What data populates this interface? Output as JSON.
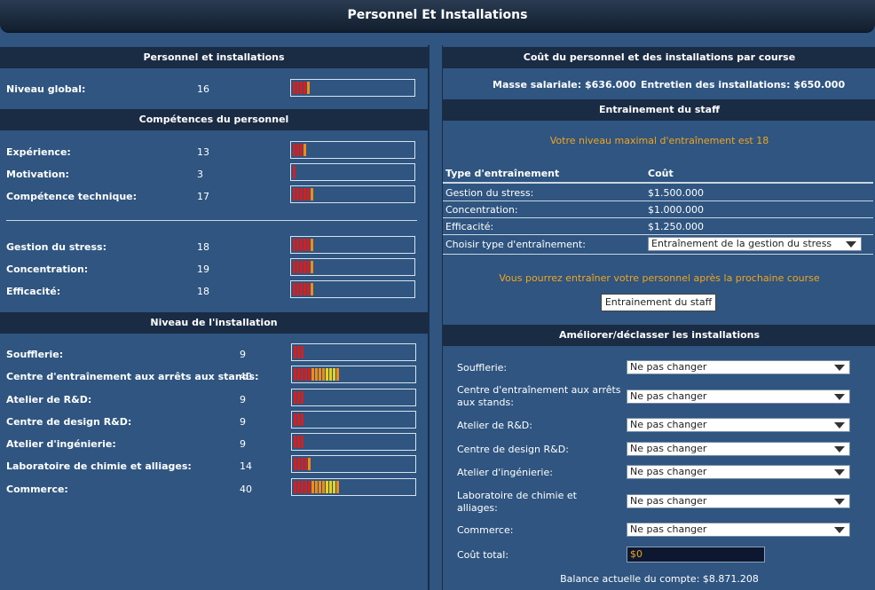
{
  "page_title": "Personnel Et Installations",
  "left": {
    "personnel_header": "Personnel et installations",
    "global": {
      "label": "Niveau global:",
      "value": "16",
      "level": 16
    },
    "skills_header": "Compétences du personnel",
    "skills": [
      {
        "label": "Expérience:",
        "value": "13",
        "level": 13
      },
      {
        "label": "Motivation:",
        "value": "3",
        "level": 3
      },
      {
        "label": "Compétence technique:",
        "value": "17",
        "level": 17
      }
    ],
    "training_skills": [
      {
        "label": "Gestion du stress:",
        "value": "18",
        "level": 18
      },
      {
        "label": "Concentration:",
        "value": "19",
        "level": 19
      },
      {
        "label": "Efficacité:",
        "value": "18",
        "level": 18
      }
    ],
    "facility_header": "Niveau de l'installation",
    "facilities": [
      {
        "label": "Soufflerie:",
        "value": "9",
        "level": 9
      },
      {
        "label": "Centre d'entraînement aux arrêts aux stands:",
        "value": "40",
        "level": 40
      },
      {
        "label": "Atelier de R&D:",
        "value": "9",
        "level": 9
      },
      {
        "label": "Centre de design R&D:",
        "value": "9",
        "level": 9
      },
      {
        "label": "Atelier d'ingénierie:",
        "value": "9",
        "level": 9
      },
      {
        "label": "Laboratoire de chimie et alliages:",
        "value": "14",
        "level": 14
      },
      {
        "label": "Commerce:",
        "value": "40",
        "level": 40
      }
    ]
  },
  "right": {
    "cost_header": "Coût du personnel et des installations par course",
    "salary": "Masse salariale: $636.000",
    "maintenance": "Entretien des installations: $650.000",
    "staff_training_header": "Entrainement du staff",
    "max_training_msg": "Votre niveau maximal d'entraînement est 18",
    "table_headers": {
      "type": "Type d'entraînement",
      "cost": "Coût"
    },
    "training_rows": [
      {
        "type": "Gestion du stress:",
        "cost": "$1.500.000"
      },
      {
        "type": "Concentration:",
        "cost": "$1.000.000"
      },
      {
        "type": "Efficacité:",
        "cost": "$1.250.000"
      }
    ],
    "choose_label": "Choisir type d'entraînement:",
    "choose_value": "Entraînement de la gestion du stress",
    "next_race_msg": "Vous pourrez entraîner votre personnel après la prochaine course",
    "train_button": "Entrainement du staff",
    "upgrade_header": "Améliorer/déclasser les installations",
    "upgrade_rows": [
      {
        "label": "Soufflerie:",
        "value": "Ne pas changer"
      },
      {
        "label": "Centre d'entraînement aux arrêts aux stands:",
        "value": "Ne pas changer"
      },
      {
        "label": "Atelier de R&D:",
        "value": "Ne pas changer"
      },
      {
        "label": "Centre de design R&D:",
        "value": "Ne pas changer"
      },
      {
        "label": "Atelier d'ingénierie:",
        "value": "Ne pas changer"
      },
      {
        "label": "Laboratoire de chimie et alliages:",
        "value": "Ne pas changer"
      },
      {
        "label": "Commerce:",
        "value": "Ne pas changer"
      }
    ],
    "total_cost_label": "Coût total:",
    "total_cost_value": "$0",
    "balance": "Balance actuelle du compte: $8.871.208"
  },
  "bar_colors": {
    "red": "#d41f1f",
    "orange": "#f08c14",
    "yellow": "#e8d21c",
    "outline": "#d8e3ee"
  }
}
